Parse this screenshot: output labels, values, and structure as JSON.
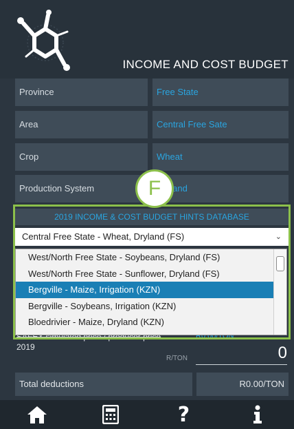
{
  "header": {
    "title": "INCOME AND COST BUDGET"
  },
  "form": {
    "rows": [
      {
        "label": "Province",
        "value": "Free State"
      },
      {
        "label": "Area",
        "value": "Central Free Sate"
      },
      {
        "label": "Crop",
        "value": "Wheat"
      },
      {
        "label": "Production System",
        "value": "Dryland"
      }
    ]
  },
  "annotation": {
    "letter": "F",
    "color": "#8cc04b"
  },
  "hints": {
    "title": "2019 INCOME & COST BUDGET HINTS DATABASE",
    "selected": "Central Free State - Wheat, Dryland (FS)",
    "options": [
      "West/North Free State - Soybeans, Dryland (FS)",
      "West/North Free State - Sunflower, Dryland (FS)",
      "Bergville - Maize, Irrigation (KZN)",
      "Bergville - Soybeans, Irrigation (KZN)",
      "Bloedrivier - Maize, Dryland (KZN)"
    ],
    "highlighted_index": 2
  },
  "price": {
    "label_line1": "SAFEX simulated price / producer price",
    "label_line2": "2019",
    "hint_value": "R0.00/TON",
    "unit": "R/TON",
    "value": "0"
  },
  "deductions": {
    "label": "Total deductions",
    "value": "R0.00/TON"
  },
  "bottom_nav": {
    "items": [
      {
        "icon": "home-icon"
      },
      {
        "icon": "calculator-icon"
      },
      {
        "icon": "help-icon",
        "glyph": "?"
      },
      {
        "icon": "info-icon"
      }
    ]
  },
  "colors": {
    "accent_blue": "#2aa5e0",
    "highlight_green": "#8cc04b",
    "selected_option": "#1a7fb5"
  }
}
